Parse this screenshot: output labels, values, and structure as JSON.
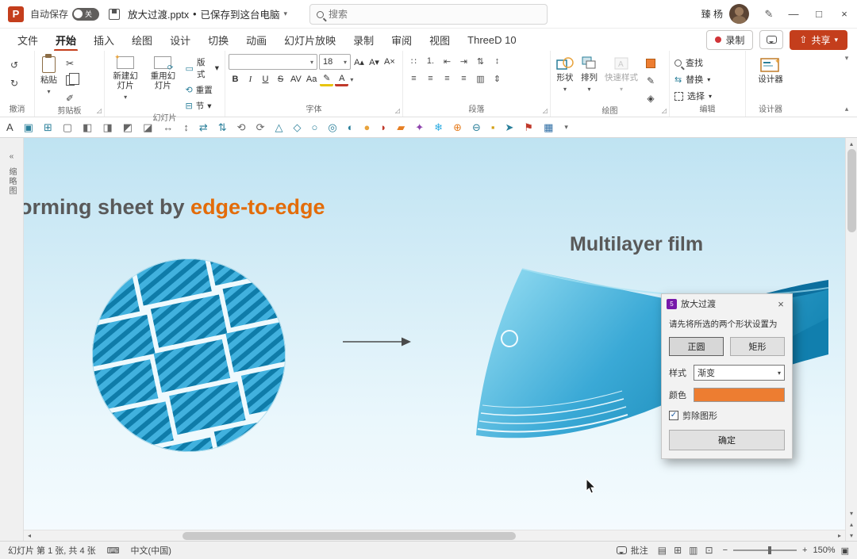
{
  "titlebar": {
    "autosave_label": "自动保存",
    "autosave_state": "关",
    "filename": "放大过渡.pptx",
    "separator": "•",
    "file_status": "已保存到这台电脑",
    "search_placeholder": "搜索",
    "user_name": "臻 杨"
  },
  "tabs": {
    "file": "文件",
    "home": "开始",
    "insert": "插入",
    "draw": "绘图",
    "design": "设计",
    "transitions": "切换",
    "animations": "动画",
    "slideshow": "幻灯片放映",
    "record_tab": "录制",
    "review": "审阅",
    "view": "视图",
    "threed": "ThreeD 10",
    "record_button": "录制",
    "share_button": "共享"
  },
  "ribbon": {
    "undo_label": "撤消",
    "clipboard": {
      "label": "剪贴板",
      "paste": "粘贴"
    },
    "slides": {
      "label": "幻灯片",
      "new_slide": "新建幻灯片",
      "reuse": "重用幻灯片",
      "layout": "版式",
      "reset": "重置",
      "section": "节"
    },
    "font": {
      "label": "字体",
      "name": "",
      "size": "18"
    },
    "paragraph": {
      "label": "段落"
    },
    "drawing": {
      "label": "绘图",
      "shapes": "形状",
      "arrange": "排列",
      "quick_styles": "快速样式"
    },
    "editing": {
      "label": "编辑",
      "find": "查找",
      "replace": "替换",
      "select": "选择"
    },
    "designer": {
      "label": "设计器"
    }
  },
  "font_icons": {
    "bold": "B",
    "italic": "I",
    "underline": "U",
    "strike": "S",
    "spacing": "AV",
    "case": "Aa",
    "grow": "A▴",
    "shrink": "A▾",
    "clear": "A×",
    "highlight": "✎",
    "color": "A"
  },
  "para_icons_row1": [
    {
      "g": "∷",
      "n": "bullets-icon"
    },
    {
      "g": "1.",
      "n": "numbering-icon"
    },
    {
      "g": "⇤",
      "n": "decrease-indent-icon"
    },
    {
      "g": "⇥",
      "n": "increase-indent-icon"
    },
    {
      "g": "⇅",
      "n": "line-spacing-icon"
    },
    {
      "g": "↕",
      "n": "text-direction-icon"
    }
  ],
  "para_icons_row2": [
    {
      "g": "≡",
      "n": "align-left-icon"
    },
    {
      "g": "≡",
      "n": "align-center-icon"
    },
    {
      "g": "≡",
      "n": "align-right-icon"
    },
    {
      "g": "≡",
      "n": "justify-icon"
    },
    {
      "g": "▥",
      "n": "columns-icon"
    },
    {
      "g": "⇕",
      "n": "align-text-icon"
    }
  ],
  "quick_icons": [
    {
      "g": "A",
      "n": "textbox-icon",
      "c": "#3f3f3f"
    },
    {
      "g": "▣",
      "n": "slide-frame-icon",
      "c": "#2a7f9a"
    },
    {
      "g": "⊞",
      "n": "table-icon",
      "c": "#2a7f9a"
    },
    {
      "g": "▢",
      "n": "placeholder-icon",
      "c": "#666666"
    },
    {
      "g": "◧",
      "n": "align-left-objects-icon",
      "c": "#666666"
    },
    {
      "g": "◨",
      "n": "align-right-objects-icon",
      "c": "#666666"
    },
    {
      "g": "◩",
      "n": "align-top-objects-icon",
      "c": "#666666"
    },
    {
      "g": "◪",
      "n": "align-bottom-objects-icon",
      "c": "#666666"
    },
    {
      "g": "↔",
      "n": "distribute-horizontal-icon",
      "c": "#666666"
    },
    {
      "g": "↕",
      "n": "distribute-vertical-icon",
      "c": "#666666"
    },
    {
      "g": "⇄",
      "n": "swap-horizontal-icon",
      "c": "#2a7f9a"
    },
    {
      "g": "⇅",
      "n": "swap-vertical-icon",
      "c": "#2a7f9a"
    },
    {
      "g": "⟲",
      "n": "rotate-left-icon",
      "c": "#666666"
    },
    {
      "g": "⟳",
      "n": "rotate-right-icon",
      "c": "#666666"
    },
    {
      "g": "△",
      "n": "triangle-shape-icon",
      "c": "#2a7f9a"
    },
    {
      "g": "◇",
      "n": "diamond-shape-icon",
      "c": "#2a7f9a"
    },
    {
      "g": "○",
      "n": "oval-shape-icon",
      "c": "#2a7f9a"
    },
    {
      "g": "◎",
      "n": "donut-shape-icon",
      "c": "#2a7f9a"
    },
    {
      "g": "◐",
      "n": "half-circle-icon",
      "c": "#2a7f9a"
    },
    {
      "g": "●",
      "n": "person-placeholder-icon",
      "c": "#e8a33d"
    },
    {
      "g": "◗",
      "n": "lips-icon",
      "c": "#c0392b"
    },
    {
      "g": "▰",
      "n": "picture-icon",
      "c": "#e67e22"
    },
    {
      "g": "✦",
      "n": "sparkle-icon",
      "c": "#8e44ad"
    },
    {
      "g": "❄",
      "n": "snowflake-icon",
      "c": "#29abe2"
    },
    {
      "g": "⊕",
      "n": "merge-shapes-icon",
      "c": "#e67e22"
    },
    {
      "g": "⊖",
      "n": "subtract-shapes-icon",
      "c": "#2a7f9a"
    },
    {
      "g": "▪",
      "n": "lock-icon",
      "c": "#d4a017"
    },
    {
      "g": "➤",
      "n": "pointer-icon",
      "c": "#2a7f9a"
    },
    {
      "g": "⚑",
      "n": "flag-icon",
      "c": "#c0392b"
    },
    {
      "g": "▦",
      "n": "save-grid-icon",
      "c": "#2e6da4"
    }
  ],
  "left_pane_label": "缩略图",
  "slide": {
    "heading_prefix": "orming sheet by ",
    "heading_highlight": "edge-to-edge",
    "subtitle": "Multilayer film"
  },
  "dialog": {
    "title": "放大过渡",
    "addin_glyph": "5",
    "instruction": "请先将所选的两个形状设置为",
    "btn_circle": "正圆",
    "btn_rect": "矩形",
    "style_label": "样式",
    "style_value": "渐变",
    "color_label": "颜色",
    "color_value": "#ED7D31",
    "checkbox_label": "剪除图形",
    "ok_label": "确定"
  },
  "statusbar": {
    "slide_info": "幻灯片 第 1 张, 共 4 张",
    "language": "中文(中国)",
    "notes_label": "批注",
    "zoom_percent": "150%"
  },
  "glyphs": {
    "undo": "↺",
    "redo": "↻",
    "caret": "▾",
    "chev_down": "▾",
    "minimize": "—",
    "maximize": "□",
    "close": "×",
    "ink": "✎",
    "cut": "✂",
    "painter": "✐",
    "layout_ic": "▭",
    "reset_ic": "⟲",
    "section_ic": "⊟",
    "outline_ic": "✎",
    "effects_ic": "◈",
    "replace_ic": "⇆",
    "launcher": "◿",
    "collapse": "▴",
    "overflow": "▾",
    "scroll_up": "▴",
    "scroll_down": "▾",
    "scroll_left": "◂",
    "scroll_right": "▸",
    "prev_slide": "▴",
    "next_slide": "▾",
    "pane_collapse": "«",
    "keyboard": "⌨",
    "zoom_minus": "−",
    "zoom_plus": "+",
    "fit": "▣",
    "check": "✓"
  },
  "status_views": [
    {
      "g": "▤",
      "n": "normal-view-icon"
    },
    {
      "g": "⊞",
      "n": "slide-sorter-icon"
    },
    {
      "g": "▥",
      "n": "reading-view-icon"
    },
    {
      "g": "⊡",
      "n": "slideshow-icon"
    }
  ]
}
